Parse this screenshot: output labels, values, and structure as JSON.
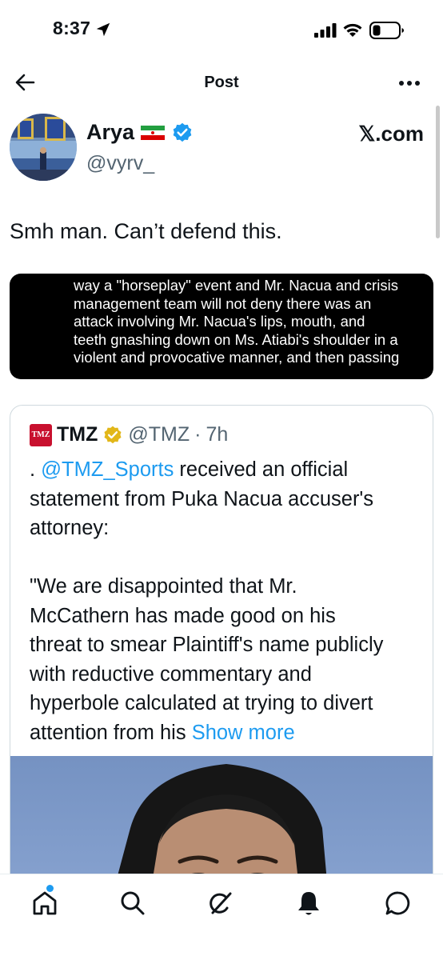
{
  "status_bar": {
    "time": "8:37",
    "icons": [
      "location-arrow-icon",
      "signal-icon",
      "wifi-icon",
      "battery-icon"
    ]
  },
  "header": {
    "title": "Post",
    "back_icon": "back-arrow-icon",
    "more_icon": "more-icon"
  },
  "author": {
    "name": "Arya",
    "flag": "iran-flag-icon",
    "verified": true,
    "handle": "@vyrv_",
    "source_label": "𝕏.com"
  },
  "post": {
    "text": "Smh man. Can’t defend this."
  },
  "attachment": {
    "lines": [
      "way a \"horseplay\" event and Mr. Nacua and crisis",
      "management team will not deny there was an",
      "attack involving Mr. Nacua's lips, mouth, and",
      "teeth gnashing down on Ms. Atiabi's shoulder in a",
      "violent and provocative manner, and then passing"
    ]
  },
  "quote": {
    "name": "TMZ",
    "logo_text": "TMZ",
    "verified_color": "#e2b719",
    "handle": "@TMZ",
    "separator": "·",
    "time": "7h",
    "line1_prefix": ". ",
    "line1_mention": "@TMZ_Sports",
    "line1_rest": " received an official",
    "line2": "statement from Puka Nacua accuser's",
    "line3": "attorney:",
    "line5": "\"We are disappointed that Mr.",
    "line6": "McCathern has made good on his",
    "line7": "threat to smear Plaintiff's name publicly",
    "line8": "with reductive commentary and",
    "line9": "hyperbole calculated at trying to divert",
    "line10_text": "attention from his ",
    "show_more": "Show more"
  },
  "tab_bar": {
    "tabs": [
      "home-icon",
      "search-icon",
      "grok-icon",
      "notifications-icon",
      "messages-icon"
    ],
    "accent_color": "#1d9bf0"
  }
}
